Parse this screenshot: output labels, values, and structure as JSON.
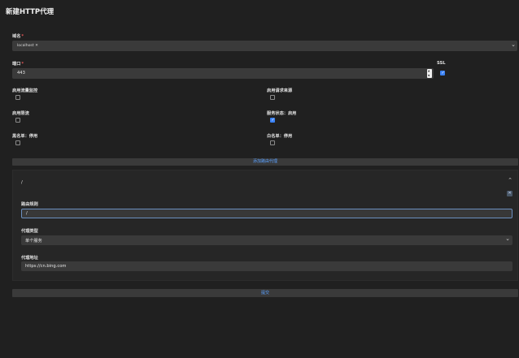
{
  "page": {
    "title": "新建HTTP代理"
  },
  "domain_field": {
    "label": "域名",
    "required_mark": "*",
    "chip_text": "localhost",
    "chip_remove": "✕",
    "dropdown_icon": "chevron-down-icon"
  },
  "port_field": {
    "label": "端口",
    "required_mark": "*",
    "value": "443",
    "stepper_up": "▲",
    "stepper_down": "▼"
  },
  "ssl": {
    "label": "SSL",
    "checked": true
  },
  "toggles": {
    "access_log": {
      "label": "启用流量监控",
      "checked": false
    },
    "request_source": {
      "label": "启用请求来源",
      "checked": false
    },
    "compression": {
      "label": "启用限流",
      "checked": false
    },
    "service_status": {
      "label": "服务状态：启用",
      "checked": true
    },
    "blacklist": {
      "label": "黑名单：停用",
      "checked": false
    },
    "whitelist": {
      "label": "白名单：停用",
      "checked": false
    }
  },
  "add_route_button": {
    "label": "添加路由代理"
  },
  "route_panel": {
    "path_title": "/",
    "collapse_icon": "chevron-up-icon",
    "remove_icon": "close-icon",
    "route_match": {
      "label": "路由规则",
      "value": "/"
    },
    "proxy_type": {
      "label": "代理类型",
      "value": "单个服务"
    },
    "proxy_address": {
      "label": "代理地址",
      "value": "https://cn.bing.com"
    }
  },
  "submit_button": {
    "label": "提交"
  },
  "colors": {
    "background": "#202020",
    "field": "#3a3a3a",
    "accent": "#3b82f6",
    "required": "#e05656"
  }
}
